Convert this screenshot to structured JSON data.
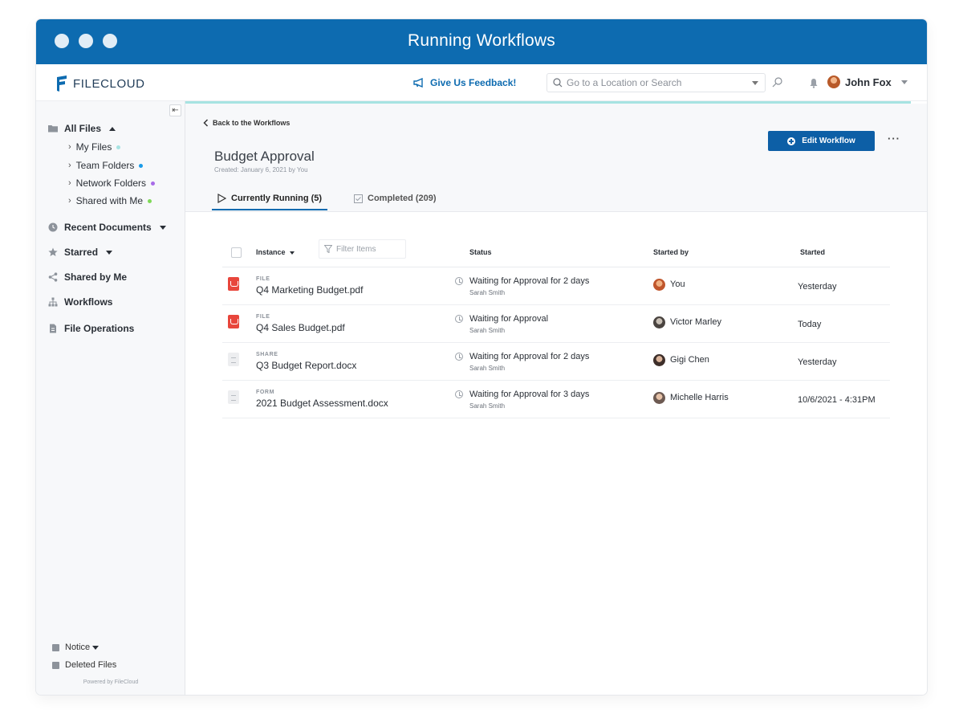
{
  "window": {
    "title": "Running Workflows"
  },
  "topbar": {
    "brand": "FILECLOUD",
    "feedback": "Give Us Feedback!",
    "search_placeholder": "Go to a Location or Search",
    "user_name": "John Fox"
  },
  "sidebar": {
    "all_files": "All Files",
    "sub_items": [
      {
        "label": "My Files",
        "dot_color": "#a7e3e2"
      },
      {
        "label": "Team Folders",
        "dot_color": "#1a9be8"
      },
      {
        "label": "Network Folders",
        "dot_color": "#a86be8"
      },
      {
        "label": "Shared with Me",
        "dot_color": "#7ed957"
      }
    ],
    "recent_documents": "Recent Documents",
    "starred": "Starred",
    "shared_by_me": "Shared by Me",
    "workflows": "Workflows",
    "file_operations": "File Operations",
    "notice": "Notice",
    "deleted_files": "Deleted Files",
    "powered_by": "Powered by FileCloud"
  },
  "workflow": {
    "back_link": "Back to the Workflows",
    "title": "Budget Approval",
    "created": "Created: January 6, 2021 by You",
    "edit_button": "Edit Workflow",
    "tabs": {
      "running": "Currently Running (5)",
      "completed": "Completed (209)"
    }
  },
  "table": {
    "columns": {
      "instance": "Instance",
      "filter_placeholder": "Filter Items",
      "status": "Status",
      "started_by": "Started by",
      "started": "Started"
    },
    "rows": [
      {
        "kind": "FILE",
        "name": "Q4 Marketing Budget.pdf",
        "status": "Waiting for Approval for 2 days",
        "assignee": "Sarah Smith",
        "started_by": "You",
        "started": "Yesterday"
      },
      {
        "kind": "FILE",
        "name": "Q4 Sales Budget.pdf",
        "status": "Waiting for Approval",
        "assignee": "Sarah Smith",
        "started_by": "Victor Marley",
        "started": "Today"
      },
      {
        "kind": "SHARE",
        "name": "Q3 Budget Report.docx",
        "status": "Waiting for Approval for 2 days",
        "assignee": "Sarah Smith",
        "started_by": "Gigi Chen",
        "started": "Yesterday"
      },
      {
        "kind": "FORM",
        "name": "2021 Budget Assessment.docx",
        "status": "Waiting for Approval for 3 days",
        "assignee": "Sarah Smith",
        "started_by": "Michelle Harris",
        "started": "10/6/2021 - 4:31PM"
      }
    ]
  },
  "colors": {
    "brand_blue": "#0d6bb0",
    "button_blue": "#0d5fa6",
    "progress_teal": "#a7e3e2",
    "pdf_red": "#e8463c"
  }
}
